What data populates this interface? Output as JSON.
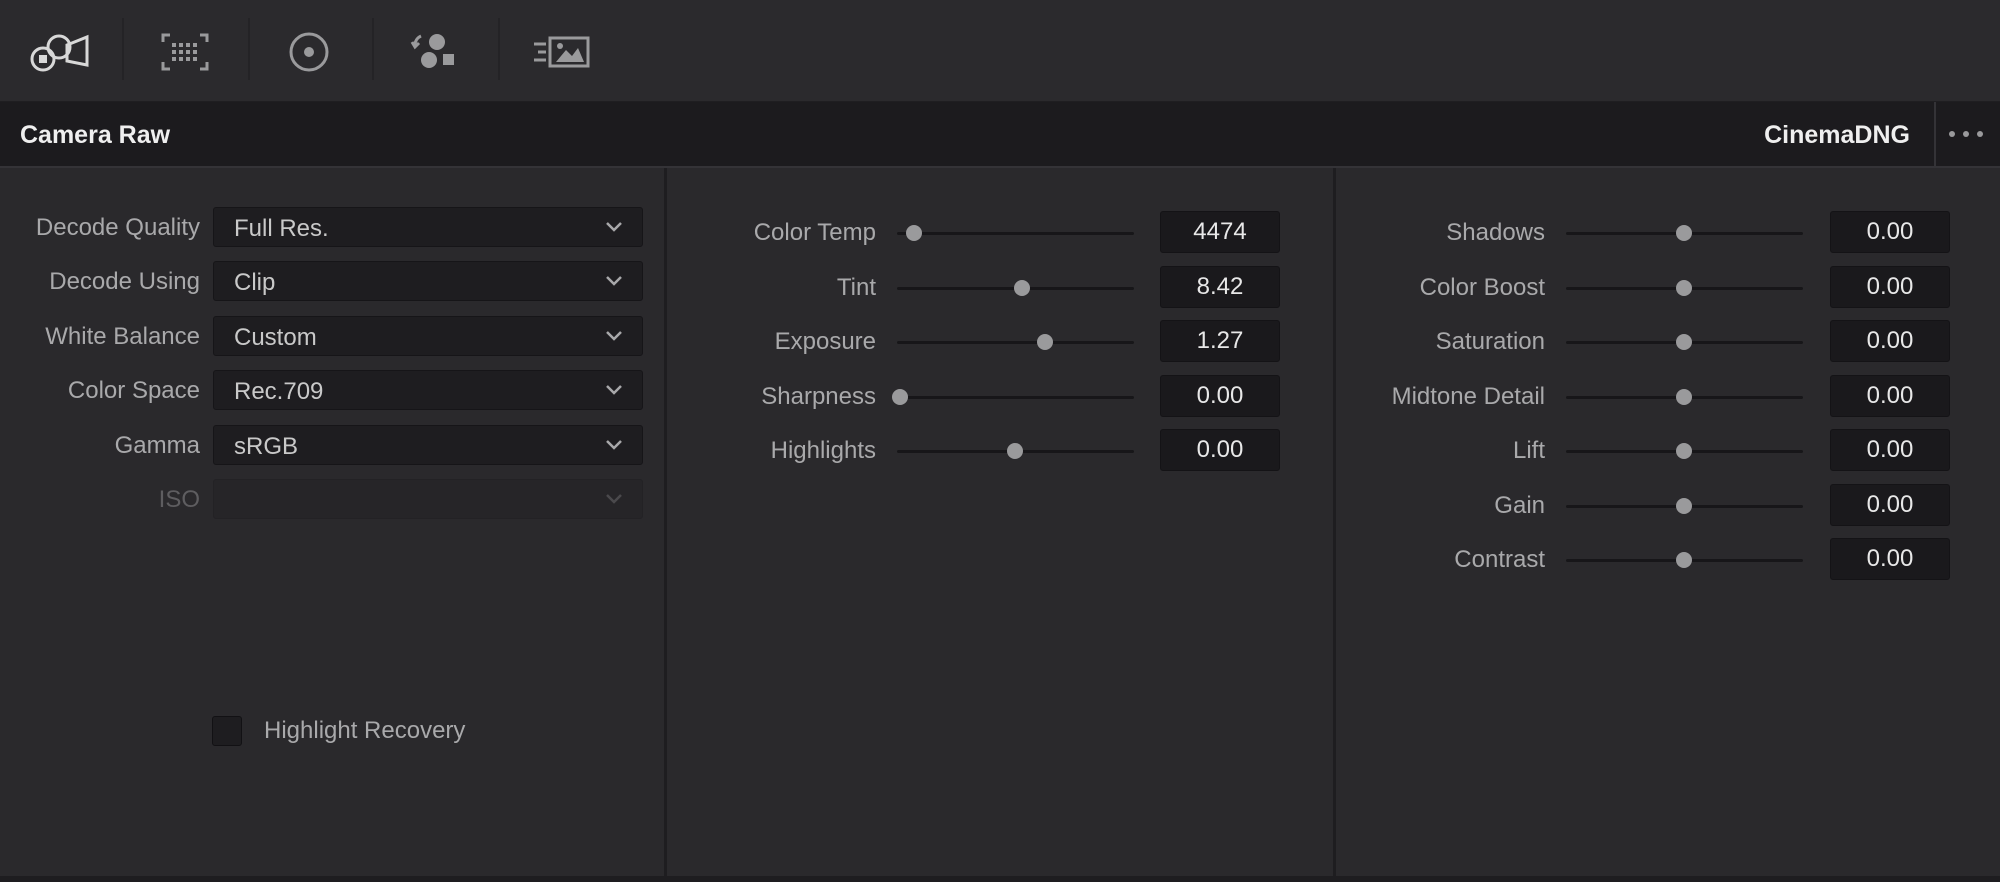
{
  "toolbar": {
    "tools": [
      {
        "name": "camera-raw-tool",
        "icon": "camera-raw-icon"
      },
      {
        "name": "color-match-tool",
        "icon": "color-chart-icon"
      },
      {
        "name": "color-wheels-tool",
        "icon": "color-wheel-icon"
      },
      {
        "name": "rgb-mixer-tool",
        "icon": "rgb-mixer-icon"
      },
      {
        "name": "motion-effects-tool",
        "icon": "motion-effects-icon"
      }
    ]
  },
  "header": {
    "title": "Camera Raw",
    "format": "CinemaDNG",
    "more_icon": "more-options-icon"
  },
  "decode": {
    "fields": [
      {
        "label": "Decode Quality",
        "value": "Full Res.",
        "enabled": true
      },
      {
        "label": "Decode Using",
        "value": "Clip",
        "enabled": true
      },
      {
        "label": "White Balance",
        "value": "Custom",
        "enabled": true
      },
      {
        "label": "Color Space",
        "value": "Rec.709",
        "enabled": true
      },
      {
        "label": "Gamma",
        "value": "sRGB",
        "enabled": true
      },
      {
        "label": "ISO",
        "value": "",
        "enabled": false
      }
    ],
    "highlight_recovery": {
      "label": "Highlight Recovery",
      "checked": false
    }
  },
  "adjust_middle": {
    "sliders": [
      {
        "label": "Color Temp",
        "value": "4474",
        "position": 0.06
      },
      {
        "label": "Tint",
        "value": "8.42",
        "position": 0.53
      },
      {
        "label": "Exposure",
        "value": "1.27",
        "position": 0.63
      },
      {
        "label": "Sharpness",
        "value": "0.00",
        "position": 0.0
      },
      {
        "label": "Highlights",
        "value": "0.00",
        "position": 0.5
      }
    ]
  },
  "adjust_right": {
    "sliders": [
      {
        "label": "Shadows",
        "value": "0.00",
        "position": 0.5
      },
      {
        "label": "Color Boost",
        "value": "0.00",
        "position": 0.5
      },
      {
        "label": "Saturation",
        "value": "0.00",
        "position": 0.5
      },
      {
        "label": "Midtone Detail",
        "value": "0.00",
        "position": 0.5
      },
      {
        "label": "Lift",
        "value": "0.00",
        "position": 0.5
      },
      {
        "label": "Gain",
        "value": "0.00",
        "position": 0.5
      },
      {
        "label": "Contrast",
        "value": "0.00",
        "position": 0.5
      }
    ]
  },
  "colors": {
    "background": "#2a292c",
    "header": "#1c1b1e",
    "field": "#1e1d20",
    "knob": "#9a9a9c"
  }
}
